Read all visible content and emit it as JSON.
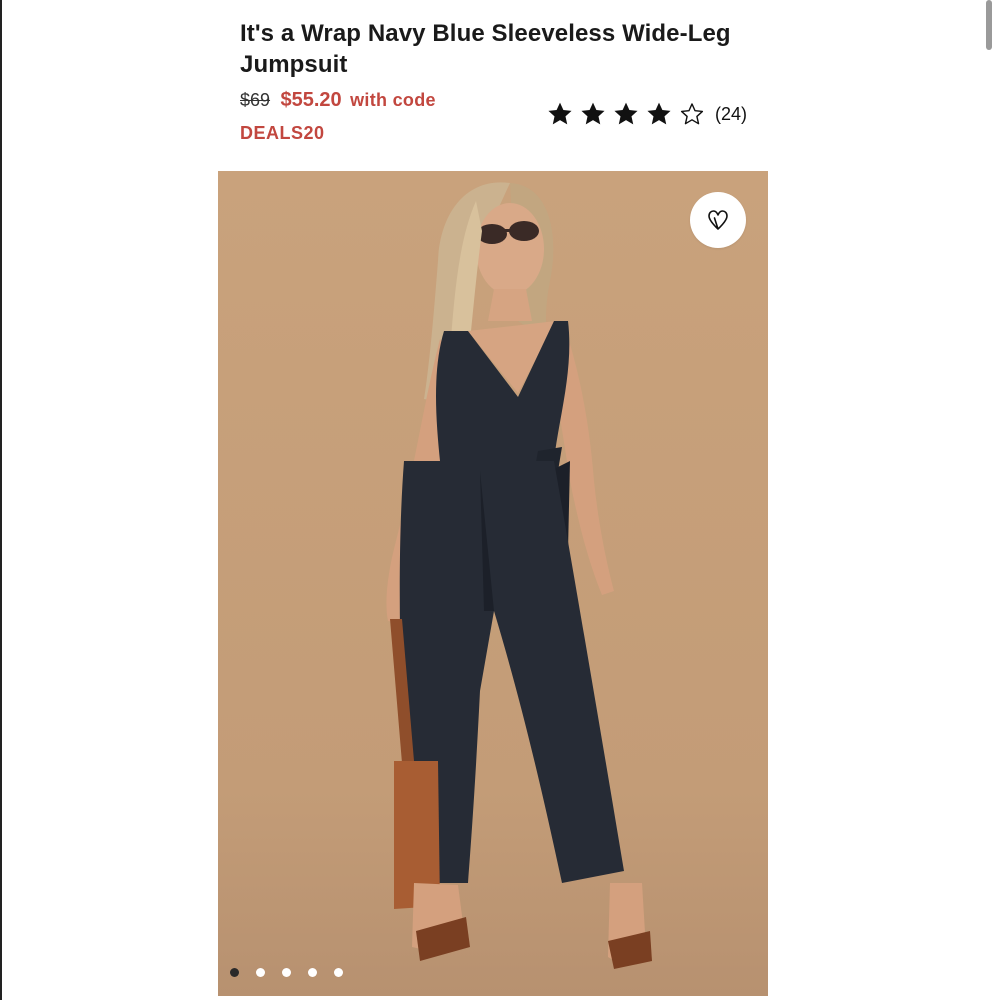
{
  "product": {
    "title": "It's a Wrap Navy Blue Sleeveless Wide-Leg Jumpsuit",
    "price": {
      "original": "$69",
      "sale": "$55.20",
      "code_prefix": "with code",
      "code": "DEALS20"
    },
    "rating": {
      "stars": 4,
      "max_stars": 5,
      "review_count": "(24)"
    }
  },
  "gallery": {
    "image_count": 5,
    "active_index": 0
  },
  "icons": {
    "wishlist": "heart-icon",
    "star_filled": "star-filled-icon",
    "star_empty": "star-outline-icon"
  },
  "colors": {
    "sale_red": "#c2473f",
    "image_background": "#c9a27d",
    "garment_navy": "#262b35"
  }
}
